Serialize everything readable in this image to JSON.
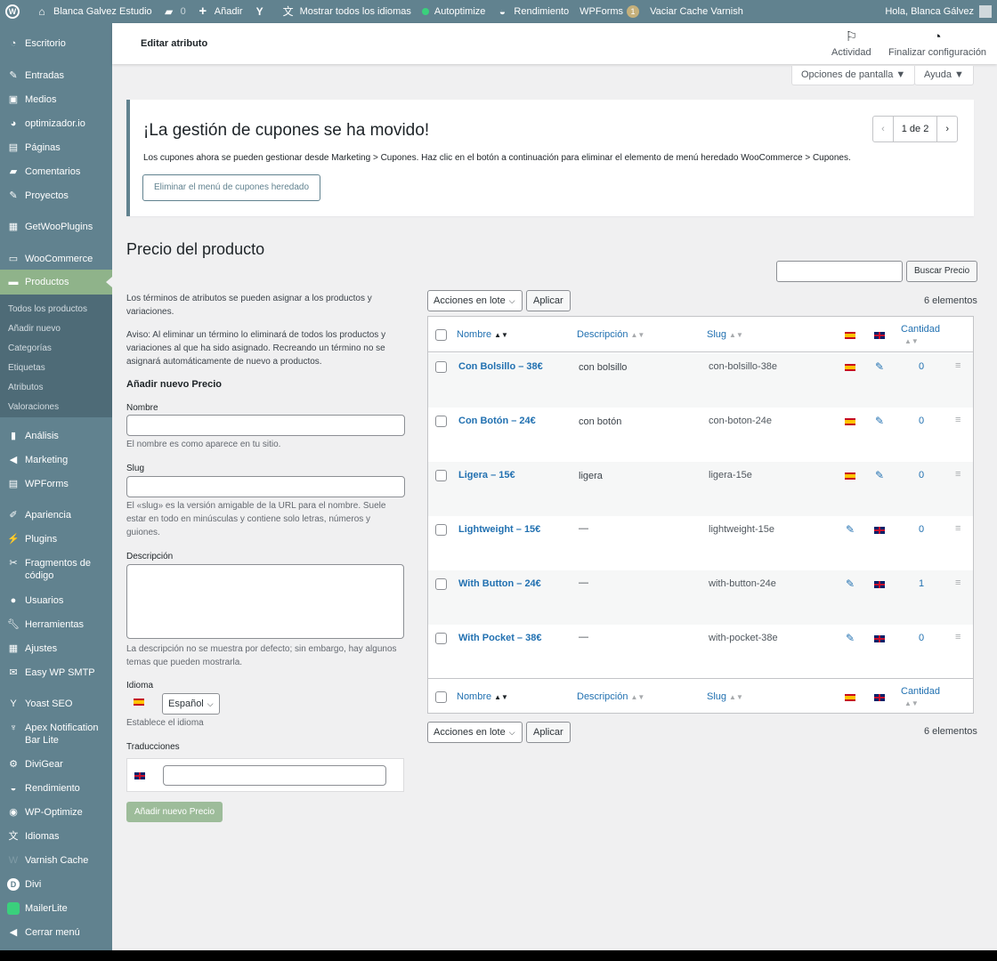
{
  "adminbar": {
    "site_name": "Blanca Galvez Estudio",
    "comments_count": "0",
    "add_new": "Añadir",
    "languages": "Mostrar todos los idiomas",
    "autoptimize": "Autoptimize",
    "performance": "Rendimiento",
    "wpforms": "WPForms",
    "wpforms_badge": "1",
    "varnish": "Vaciar Cache Varnish",
    "greeting": "Hola, Blanca Gálvez"
  },
  "sidebar": {
    "items": [
      {
        "label": "Escritorio",
        "icon": "dashboard-icon"
      },
      {
        "label": "Entradas",
        "icon": "pin-icon"
      },
      {
        "label": "Medios",
        "icon": "media-icon"
      },
      {
        "label": "optimizador.io",
        "icon": "gauge-icon"
      },
      {
        "label": "Páginas",
        "icon": "pages-icon"
      },
      {
        "label": "Comentarios",
        "icon": "comment-icon"
      },
      {
        "label": "Proyectos",
        "icon": "pin-icon"
      },
      {
        "label": "GetWooPlugins",
        "icon": "plugin-box-icon"
      },
      {
        "label": "WooCommerce",
        "icon": "woo-icon"
      },
      {
        "label": "Productos",
        "icon": "archive-icon"
      },
      {
        "label": "Análisis",
        "icon": "bar-chart-icon"
      },
      {
        "label": "Marketing",
        "icon": "megaphone-icon"
      },
      {
        "label": "WPForms",
        "icon": "form-icon"
      },
      {
        "label": "Apariencia",
        "icon": "brush-icon"
      },
      {
        "label": "Plugins",
        "icon": "plug-icon"
      },
      {
        "label": "Fragmentos de código",
        "icon": "scissors-icon"
      },
      {
        "label": "Usuarios",
        "icon": "user-icon"
      },
      {
        "label": "Herramientas",
        "icon": "wrench-icon"
      },
      {
        "label": "Ajustes",
        "icon": "settings-icon"
      },
      {
        "label": "Easy WP SMTP",
        "icon": "mail-icon"
      },
      {
        "label": "Yoast SEO",
        "icon": "yoast-icon"
      },
      {
        "label": "Apex Notification Bar Lite",
        "icon": "microphone-icon"
      },
      {
        "label": "DiviGear",
        "icon": "gear-icon"
      },
      {
        "label": "Rendimiento",
        "icon": "performance-icon"
      },
      {
        "label": "WP-Optimize",
        "icon": "optimize-icon"
      },
      {
        "label": "Idiomas",
        "icon": "translate-icon"
      },
      {
        "label": "Varnish Cache",
        "icon": "varnish-icon"
      },
      {
        "label": "Divi",
        "icon": "divi-icon"
      },
      {
        "label": "MailerLite",
        "icon": "mailerlite-icon"
      },
      {
        "label": "Cerrar menú",
        "icon": "collapse-icon"
      }
    ],
    "submenu": [
      "Todos los productos",
      "Añadir nuevo",
      "Categorías",
      "Etiquetas",
      "Atributos",
      "Valoraciones"
    ]
  },
  "header": {
    "title": "Editar atributo",
    "activity": "Actividad",
    "finish_setup": "Finalizar configuración",
    "screen_options": "Opciones de pantalla ▼",
    "help": "Ayuda ▼"
  },
  "notice": {
    "title": "¡La gestión de cupones se ha movido!",
    "text": "Los cupones ahora se pueden gestionar desde Marketing > Cupones. Haz clic en el botón a continuación para eliminar el elemento de menú heredado WooCommerce > Cupones.",
    "button": "Eliminar el menú de cupones heredado",
    "pager": "1 de 2",
    "prev": "‹",
    "next": "›"
  },
  "page": {
    "title": "Precio del producto",
    "search_button": "Buscar Precio",
    "intro": "Los términos de atributos se pueden asignar a los productos y variaciones.",
    "warning": "Aviso: Al eliminar un término lo eliminará de todos los productos y variaciones al que ha sido asignado. Recreando un término no se asignará automáticamente de nuevo a productos."
  },
  "form": {
    "heading": "Añadir nuevo Precio",
    "name_label": "Nombre",
    "name_hint": "El nombre es como aparece en tu sitio.",
    "slug_label": "Slug",
    "slug_hint": "El «slug» es la versión amigable de la URL para el nombre. Suele estar en todo en minúsculas y contiene solo letras, números y guiones.",
    "desc_label": "Descripción",
    "desc_hint": "La descripción no se muestra por defecto; sin embargo, hay algunos temas que pueden mostrarla.",
    "lang_label": "Idioma",
    "lang_value": "Español",
    "lang_hint": "Establece el idioma",
    "trans_label": "Traducciones",
    "submit": "Añadir nuevo Precio"
  },
  "table": {
    "bulk_actions": "Acciones en lote",
    "apply": "Aplicar",
    "count": "6 elementos",
    "columns": {
      "name": "Nombre",
      "description": "Descripción",
      "slug": "Slug",
      "count": "Cantidad"
    },
    "rows": [
      {
        "name": "Con Bolsillo – 38€",
        "description": "con bolsillo",
        "slug": "con-bolsillo-38e",
        "lang": "es",
        "count": "0"
      },
      {
        "name": "Con Botón – 24€",
        "description": "con botón",
        "slug": "con-boton-24e",
        "lang": "es",
        "count": "0"
      },
      {
        "name": "Ligera – 15€",
        "description": "ligera",
        "slug": "ligera-15e",
        "lang": "es",
        "count": "0"
      },
      {
        "name": "Lightweight – 15€",
        "description": "—",
        "slug": "lightweight-15e",
        "lang": "en",
        "count": "0"
      },
      {
        "name": "With Button – 24€",
        "description": "—",
        "slug": "with-button-24e",
        "lang": "en",
        "count": "1"
      },
      {
        "name": "With Pocket – 38€",
        "description": "—",
        "slug": "with-pocket-38e",
        "lang": "en",
        "count": "0"
      }
    ]
  },
  "colors": {
    "sidebar": "#61828f",
    "active": "#8fb38a",
    "link": "#2271b1"
  }
}
